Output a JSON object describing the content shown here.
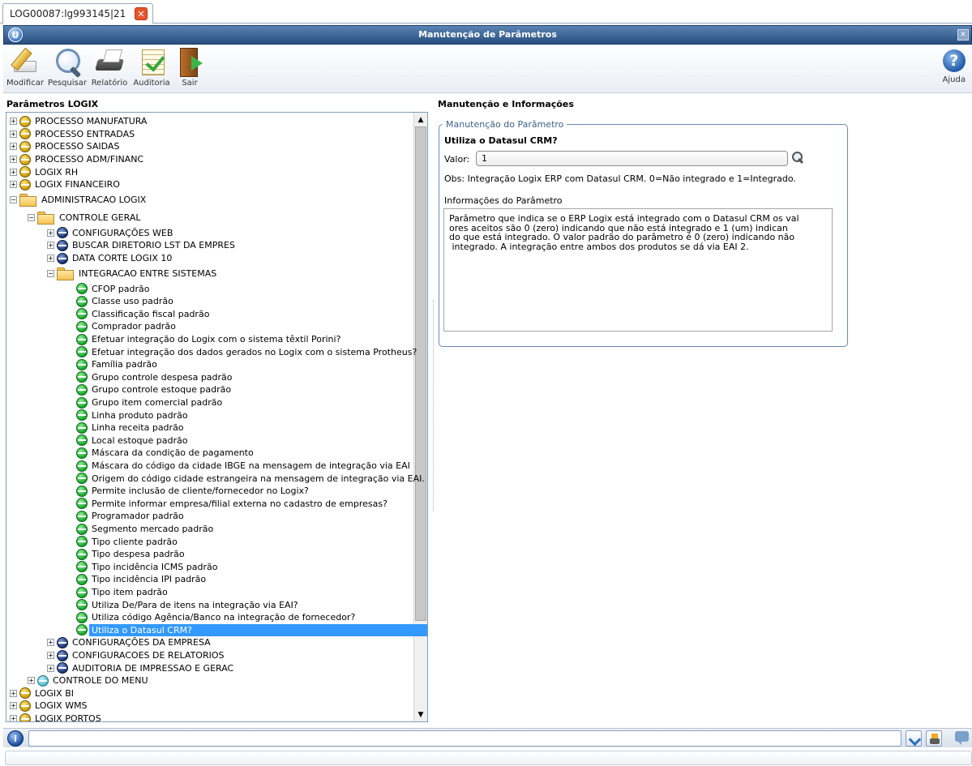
{
  "tab": {
    "label": "LOG00087:lg993145|21"
  },
  "window": {
    "title": "Manutenção de Parâmetros"
  },
  "toolbar": {
    "modify": "Modificar",
    "search": "Pesquisar",
    "report": "Relatório",
    "audit": "Auditoria",
    "exit": "Sair",
    "help": "Ajuda"
  },
  "left_panel": {
    "title": "Parâmetros LOGIX",
    "tree": {
      "top": [
        "PROCESSO MANUFATURA",
        "PROCESSO ENTRADAS",
        "PROCESSO SAIDAS",
        "PROCESSO ADM/FINANC",
        "LOGIX RH",
        "LOGIX FINANCEIRO"
      ],
      "admin": "ADMINISTRACAO LOGIX",
      "controle_geral": "CONTROLE GERAL",
      "cg_children": [
        "CONFIGURAÇÕES WEB",
        "BUSCAR DIRETORIO LST DA EMPRES",
        "DATA CORTE LOGIX 10"
      ],
      "integracao": "INTEGRACAO ENTRE SISTEMAS",
      "leaves": [
        "CFOP padrão",
        "Classe uso padrão",
        "Classificação fiscal padrão",
        "Comprador padrão",
        "Efetuar integração do Logix com o sistema têxtil Porini?",
        "Efetuar integração dos dados gerados no Logix com o sistema Protheus?",
        "Família padrão",
        "Grupo controle despesa padrão",
        "Grupo controle estoque padrão",
        "Grupo item comercial padrão",
        "Linha produto padrão",
        "Linha receita padrão",
        "Local estoque padrão",
        "Máscara da condição de pagamento",
        "Máscara do código da cidade IBGE na mensagem de integração via EAI",
        "Origem do código cidade estrangeira na mensagem de integração via EAI.",
        "Permite inclusão de cliente/fornecedor no Logix?",
        "Permite informar empresa/filial externa no cadastro de empresas?",
        "Programador padrão",
        "Segmento mercado padrão",
        "Tipo cliente padrão",
        "Tipo despesa padrão",
        "Tipo incidência ICMS padrão",
        "Tipo incidência IPI padrão",
        "Tipo item padrão",
        "Utiliza De/Para de itens na integração via EAI?",
        "Utiliza código Agência/Banco na integração de fornecedor?",
        "Utiliza o Datasul CRM?"
      ],
      "after_integracao": [
        "CONFIGURAÇÕES DA EMPRESA",
        "CONFIGURACOES DE RELATORIOS",
        "AUDITORIA DE IMPRESSAO E GERAC"
      ],
      "controle_menu": "CONTROLE DO MENU",
      "bottom": [
        "LOGIX BI",
        "LOGIX WMS",
        "LOGIX PORTOS"
      ]
    }
  },
  "right_panel": {
    "title": "Manutenção e Informações",
    "group_legend": "Manutenção do Parâmetro",
    "param_question": "Utiliza o Datasul CRM?",
    "value_label": "Valor:",
    "value": "1",
    "obs": "Obs: Integração Logix ERP com Datasul CRM. 0=Não integrado e 1=Integrado.",
    "info_label": "Informações do Parâmetro",
    "info_text": "Parâmetro que indica se o ERP Logix está integrado com o Datasul CRM os val\nores aceitos são 0 (zero) indicando que não está integrado e 1 (um) indican\ndo que está integrado. O valor padrão do parâmetro é 0 (zero) indicando não\n integrado. A integração entre ambos dos produtos se dá via EAI 2."
  }
}
